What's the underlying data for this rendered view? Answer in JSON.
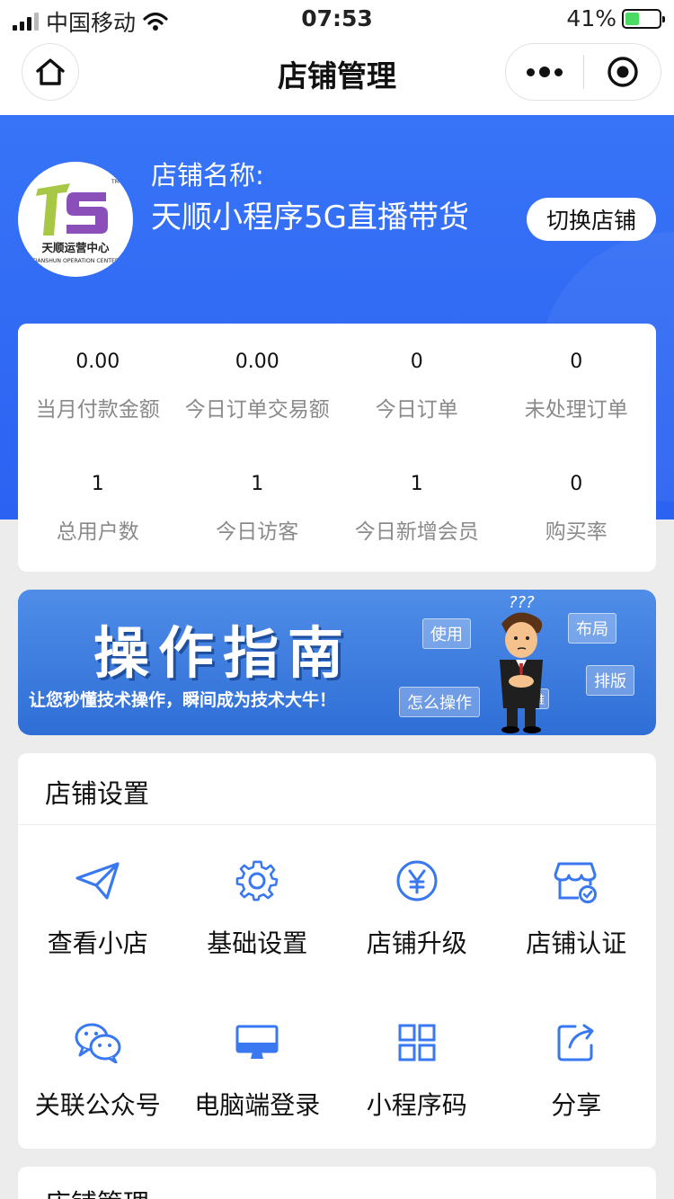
{
  "status_bar": {
    "carrier": "中国移动",
    "time": "07:53",
    "battery_pct": "41%",
    "battery_level": 0.41
  },
  "nav": {
    "title": "店铺管理"
  },
  "shop": {
    "name_label": "店铺名称:",
    "name": "天顺小程序5G直播带货",
    "switch_label": "切换店铺",
    "logo_text": "天顺运营中心",
    "logo_sub": "TIANSHUN OPERATION CENTER",
    "logo_tm": "TM"
  },
  "stats": [
    {
      "value": "0.00",
      "label": "当月付款金额"
    },
    {
      "value": "0.00",
      "label": "今日订单交易额"
    },
    {
      "value": "0",
      "label": "今日订单"
    },
    {
      "value": "0",
      "label": "未处理订单"
    },
    {
      "value": "1",
      "label": "总用户数"
    },
    {
      "value": "1",
      "label": "今日访客"
    },
    {
      "value": "1",
      "label": "今日新增会员"
    },
    {
      "value": "0",
      "label": "购买率"
    }
  ],
  "banner": {
    "title": "操作指南",
    "subtitle": "让您秒懂技术操作，瞬间成为技术大牛！",
    "tags": [
      "使用",
      "布局",
      "排版",
      "怎么操作",
      "难"
    ],
    "bubble": "???"
  },
  "settings": {
    "title": "店铺设置",
    "items": [
      {
        "label": "查看小店",
        "icon": "paper-plane-icon"
      },
      {
        "label": "基础设置",
        "icon": "gear-icon"
      },
      {
        "label": "店铺升级",
        "icon": "yen-circle-icon"
      },
      {
        "label": "店铺认证",
        "icon": "store-verified-icon"
      },
      {
        "label": "关联公众号",
        "icon": "wechat-icon"
      },
      {
        "label": "电脑端登录",
        "icon": "monitor-icon"
      },
      {
        "label": "小程序码",
        "icon": "qr-code-icon"
      },
      {
        "label": "分享",
        "icon": "share-icon"
      }
    ]
  },
  "next_section": {
    "title": "店铺管理"
  },
  "colors": {
    "accent": "#2c62f2",
    "icon_blue": "#3a78f2"
  }
}
